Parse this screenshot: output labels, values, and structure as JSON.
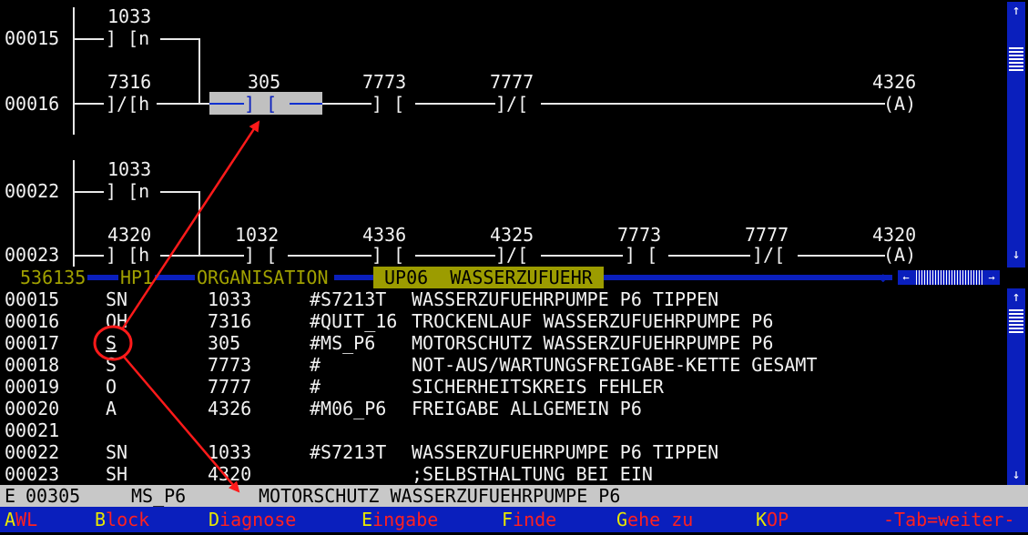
{
  "ladder": {
    "net1": {
      "addr_a": "00015",
      "addr_b": "00016",
      "top_op": "1033",
      "top_contact": "] [n",
      "contacts": [
        {
          "num": "7316",
          "sym": "]/[h"
        },
        {
          "num": "305",
          "sym": "] ["
        },
        {
          "num": "7773",
          "sym": "] ["
        },
        {
          "num": "7777",
          "sym": "]/["
        }
      ],
      "coil_num": "4326",
      "coil_sym": "(A)"
    },
    "net2": {
      "addr_a": "00022",
      "addr_b": "00023",
      "top_op": "1033",
      "top_contact": "] [n",
      "contacts": [
        {
          "num": "4320",
          "sym": "] [h"
        },
        {
          "num": "1032",
          "sym": "] ["
        },
        {
          "num": "4336",
          "sym": "] ["
        },
        {
          "num": "4325",
          "sym": "]/["
        },
        {
          "num": "7773",
          "sym": "] ["
        },
        {
          "num": "7777",
          "sym": "]/["
        }
      ],
      "coil_num": "4320",
      "coil_sym": "(A)"
    }
  },
  "divider": {
    "block": "536135",
    "hp": "HP1",
    "org": "ORGANISATION",
    "up_label": "UP06  WASSERZUFUEHR"
  },
  "listing": [
    {
      "line": "00015",
      "op": "SN",
      "operand": "1033",
      "sym": "#S7213T",
      "comment": "WASSERZUFUEHRPUMPE P6 TIPPEN"
    },
    {
      "line": "00016",
      "op": "OH",
      "operand": "7316",
      "sym": "#QUIT_16",
      "comment": "TROCKENLAUF WASSERZUFUEHRPUMPE P6"
    },
    {
      "line": "00017",
      "op": "S",
      "operand": "305",
      "sym": "#MS_P6",
      "comment": "MOTORSCHUTZ WASSERZUFUEHRPUMPE P6"
    },
    {
      "line": "00018",
      "op": "S",
      "operand": "7773",
      "sym": "#",
      "comment": "NOT-AUS/WARTUNGSFREIGABE-KETTE GESAMT"
    },
    {
      "line": "00019",
      "op": "O",
      "operand": "7777",
      "sym": "#",
      "comment": "SICHERHEITSKREIS FEHLER"
    },
    {
      "line": "00020",
      "op": "A",
      "operand": "4326",
      "sym": "#M06_P6",
      "comment": "FREIGABE ALLGEMEIN P6"
    },
    {
      "line": "00021",
      "op": "",
      "operand": "",
      "sym": "",
      "comment": ""
    },
    {
      "line": "00022",
      "op": "SN",
      "operand": "1033",
      "sym": "#S7213T",
      "comment": "WASSERZUFUEHRPUMPE P6 TIPPEN"
    },
    {
      "line": "00023",
      "op": "SH",
      "operand": "4320",
      "sym": "",
      "comment": ";SELBSTHALTUNG BEI EIN"
    }
  ],
  "status": {
    "kind": "E",
    "addr": "00305",
    "symbol": "MS_P6",
    "comment": "MOTORSCHUTZ WASSERZUFUEHRPUMPE P6"
  },
  "menu": [
    {
      "key": "A",
      "rest": "WL"
    },
    {
      "key": "B",
      "rest": "lock"
    },
    {
      "key": "D",
      "rest": "iagnose"
    },
    {
      "key": "E",
      "rest": "ingabe"
    },
    {
      "key": "F",
      "rest": "inde"
    },
    {
      "key": "G",
      "rest": "ehe zu"
    },
    {
      "key": "K",
      "rest": "OP"
    },
    {
      "key": "",
      "rest": "-Tab=weiter-"
    }
  ],
  "colors": {
    "background": "#000000",
    "text": "#f2f2f2",
    "blue_bar": "#0a1fbd",
    "olive_text": "#a0a000",
    "up_highlight": "#9c9c00",
    "status_bar": "#c8c8c8",
    "menu_key": "#e8e800",
    "menu_text": "#ff2020",
    "annotation": "#ff1a1a"
  }
}
